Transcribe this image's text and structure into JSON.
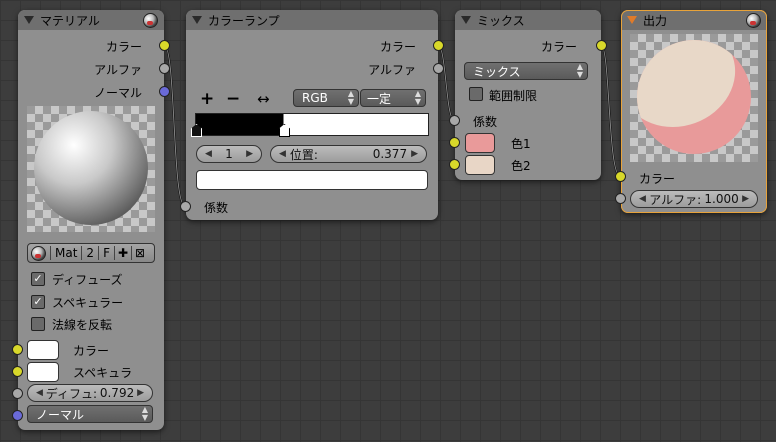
{
  "material": {
    "title": "マテリアル",
    "out_color": "カラー",
    "out_alpha": "アルファ",
    "out_normal": "ノーマル",
    "mat_name": "Mat",
    "users": "2",
    "fake": "F",
    "diffuse_label": "ディフューズ",
    "specular_label": "スペキュラー",
    "invert_normal_label": "法線を反転",
    "in_color": "カラー",
    "in_spec": "スペキュラ",
    "diffuse_field_label": "ディフュ:",
    "diffuse_value": "0.792",
    "normal_select": "ノーマル"
  },
  "colorramp": {
    "title": "カラーランプ",
    "out_color": "カラー",
    "out_alpha": "アルファ",
    "add_btn": "+",
    "remove_btn": "−",
    "flip_btn": "↔",
    "color_mode": "RGB",
    "interp": "一定",
    "index": "1",
    "pos_label": "位置:",
    "pos_value": "0.377",
    "in_fac": "係数"
  },
  "mix": {
    "title": "ミックス",
    "out_color": "カラー",
    "blend_type": "ミックス",
    "clamp_label": "範囲制限",
    "in_fac": "係数",
    "color1": "色1",
    "color2": "色2",
    "color1_hex": "#e99a9a",
    "color2_hex": "#e8d6c6"
  },
  "output": {
    "title": "出力",
    "in_color": "カラー",
    "alpha_label": "アルファ:",
    "alpha_value": "1.000"
  },
  "colors": {
    "socket_color": "#d8d82a",
    "socket_gray": "#a8a8a8",
    "socket_vector": "#6a6ad8",
    "active_outline": "#e8a33a"
  }
}
